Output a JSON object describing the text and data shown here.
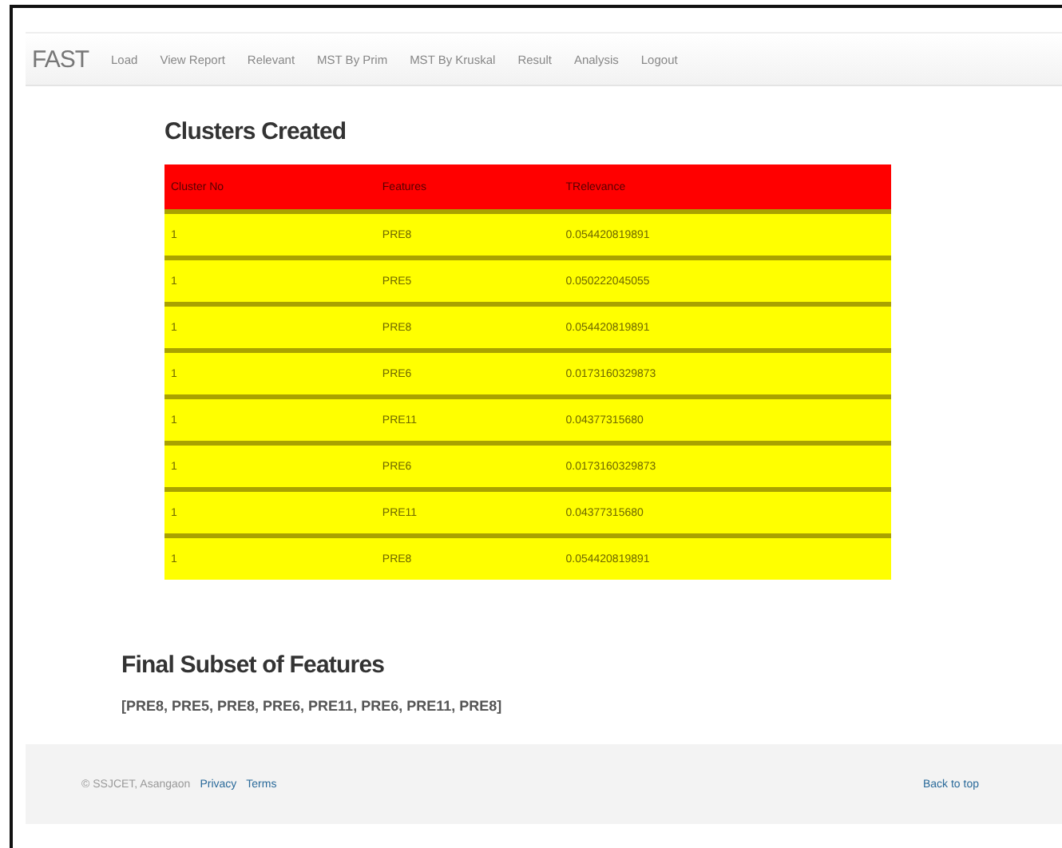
{
  "navbar": {
    "brand": "FAST",
    "links": [
      "Load",
      "View Report",
      "Relevant",
      "MST By Prim",
      "MST By Kruskal",
      "Result",
      "Analysis",
      "Logout"
    ]
  },
  "clusters": {
    "title": "Clusters Created",
    "columns": [
      "Cluster No",
      "Features",
      "TRelevance"
    ],
    "rows": [
      [
        "1",
        "PRE8",
        "0.054420819891"
      ],
      [
        "1",
        "PRE5",
        "0.050222045055"
      ],
      [
        "1",
        "PRE8",
        "0.054420819891"
      ],
      [
        "1",
        "PRE6",
        "0.0173160329873"
      ],
      [
        "1",
        "PRE11",
        "0.04377315680"
      ],
      [
        "1",
        "PRE6",
        "0.0173160329873"
      ],
      [
        "1",
        "PRE11",
        "0.04377315680"
      ],
      [
        "1",
        "PRE8",
        "0.054420819891"
      ]
    ]
  },
  "final_subset": {
    "title": "Final Subset of Features",
    "value": "[PRE8, PRE5, PRE8, PRE6, PRE11, PRE6, PRE11, PRE8]"
  },
  "footer": {
    "copyright": "© SSJCET, Asangaon",
    "links": [
      "Privacy",
      "Terms"
    ],
    "back_to_top": "Back to top"
  }
}
